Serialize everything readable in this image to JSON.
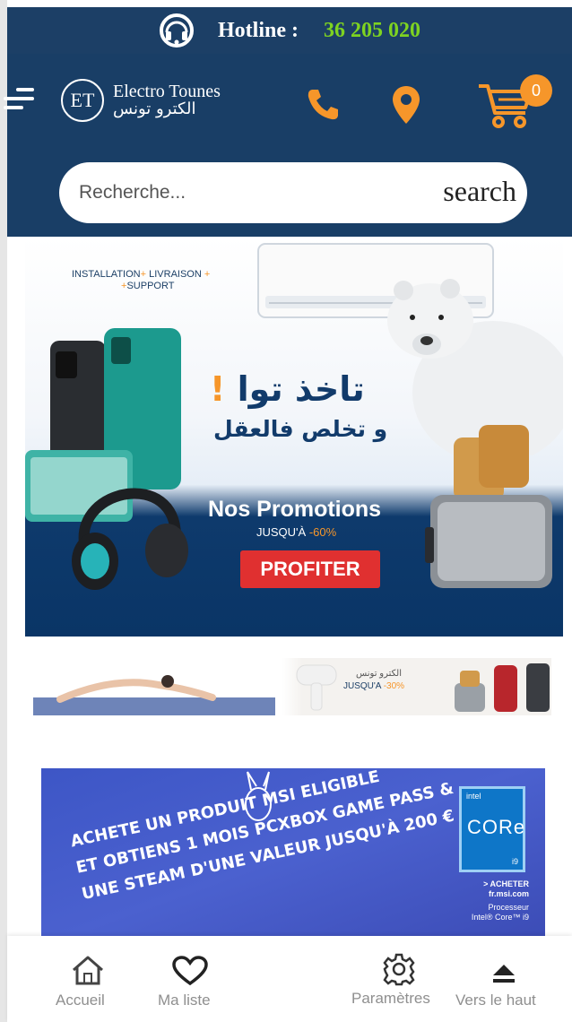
{
  "hotline": {
    "label": "Hotline :",
    "number": "36 205 020",
    "number_color": "#7ed321"
  },
  "header": {
    "logo": {
      "initials": "ET",
      "name": "Electro Tounes",
      "name_ar": "الكترو تونس"
    },
    "icons": [
      "menu-icon",
      "phone-icon",
      "location-icon",
      "cart-icon"
    ],
    "cart_count": "0",
    "accent": "#f6962a",
    "background": "#193e66"
  },
  "search": {
    "placeholder": "Recherche...",
    "button_label": "search"
  },
  "banner_main": {
    "services": [
      "INSTALLATION",
      "LIVRAISON",
      "SUPPORT"
    ],
    "headline_ar": "تاخذ توا",
    "headline_excl": "!",
    "subline_ar": "و تخلص فالعقل",
    "title": "Nos Promotions",
    "sub_prefix": "JUSQU'À",
    "sub_pct": "-60%",
    "cta": "PROFITER"
  },
  "banner_small": {
    "arabic": "الكترو تونس",
    "prefix": "JUSQU'A",
    "pct": "-30%"
  },
  "banner_purple": {
    "lines": [
      "ACHETE UN PRODUIT MSI ELIGIBLE",
      "ET OBTIENS 1 MOIS PCXBOX GAME PASS &",
      "UNE STEAM D'UNE VALEUR JUSQU'À 200 €"
    ],
    "intel_small": "intel",
    "intel_core": "CORe",
    "intel_gen": "i9",
    "acheter_line1": "> ACHETER",
    "acheter_line2": "fr.msi.com",
    "processor_line1": "Processeur",
    "processor_line2": "Intel® Core™ i9"
  },
  "bottom_nav": [
    {
      "label": "Accueil",
      "icon": "home-icon"
    },
    {
      "label": "Ma liste",
      "icon": "heart-icon"
    },
    {
      "label": "Paramètres",
      "icon": "gear-icon"
    },
    {
      "label": "Vers le haut",
      "icon": "arrow-up-icon"
    }
  ]
}
